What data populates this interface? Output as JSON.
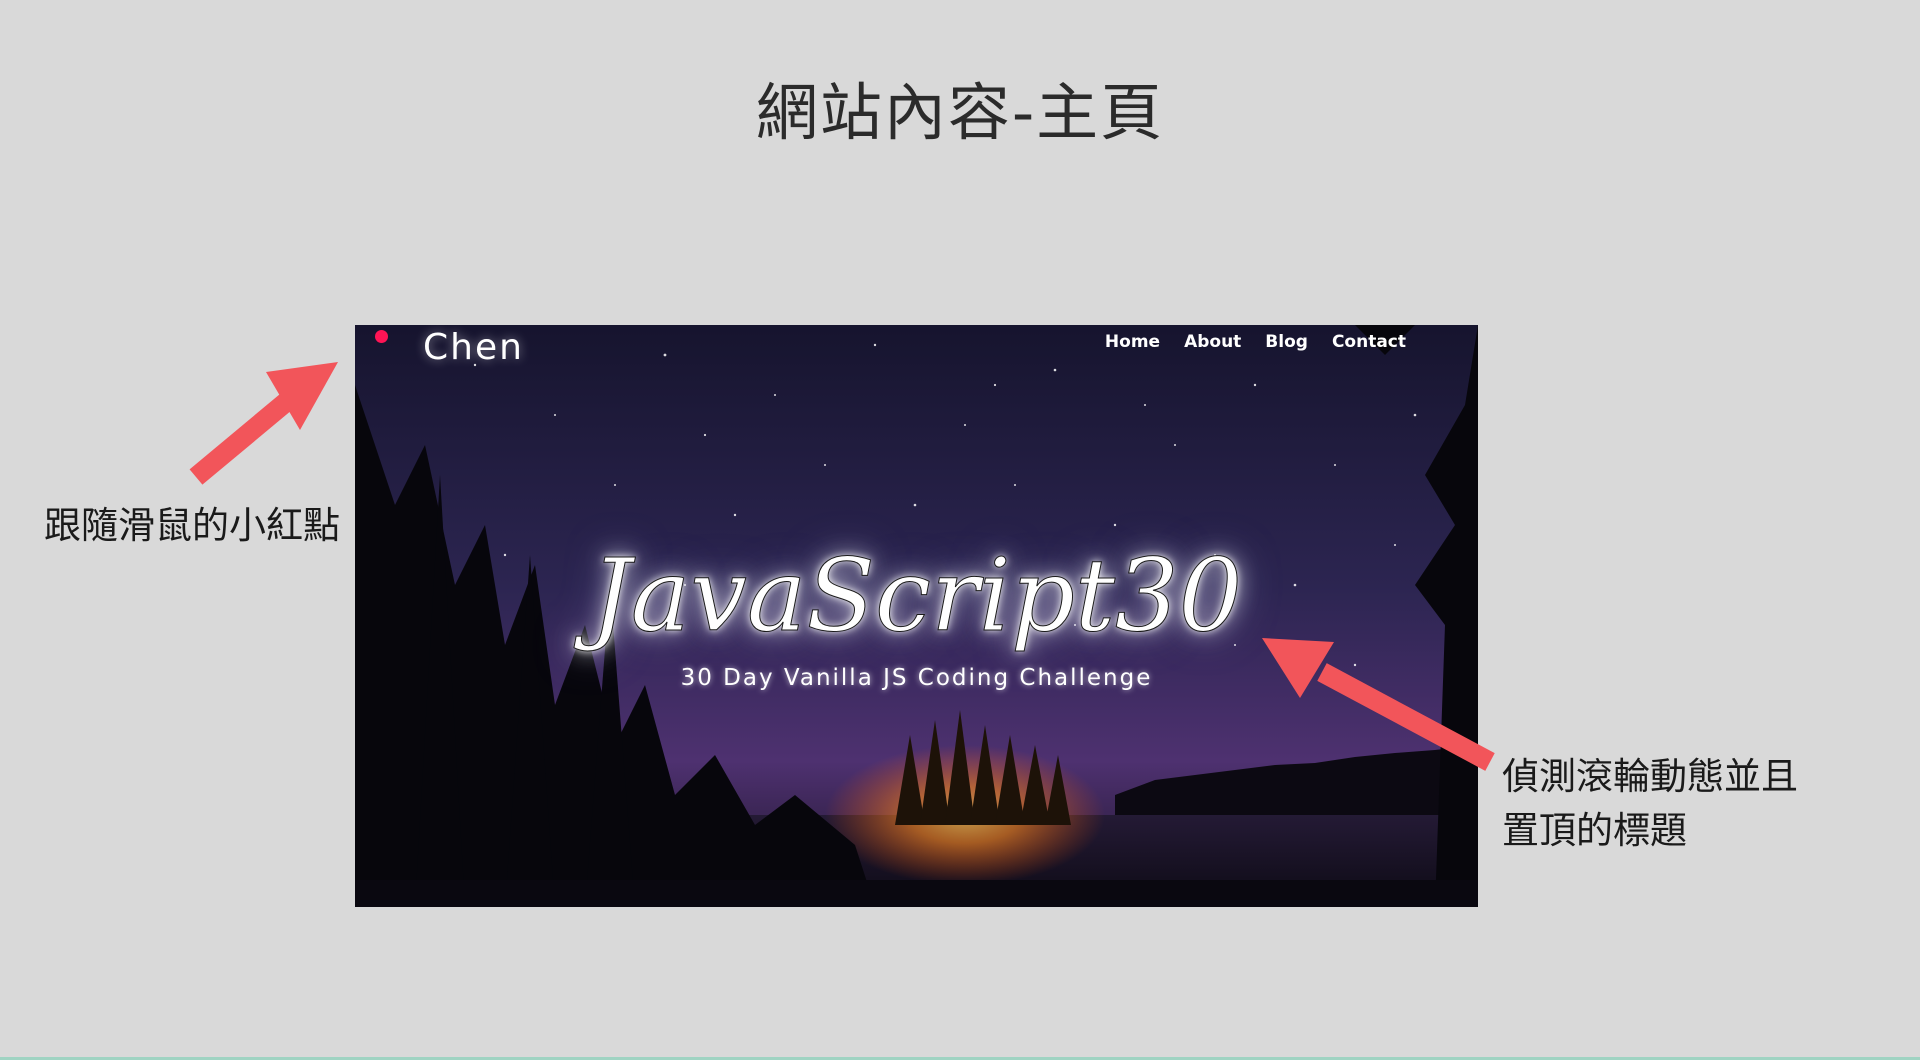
{
  "slide": {
    "title": "網站內容-主頁"
  },
  "site": {
    "logo": "Chen",
    "nav": [
      "Home",
      "About",
      "Blog",
      "Contact"
    ],
    "hero_title": "JavaScript30",
    "hero_subtitle": "30 Day Vanilla JS Coding Challenge"
  },
  "annotations": {
    "left_note": "跟隨滑鼠的小紅點",
    "right_note_line1": "偵測滾輪動態並且",
    "right_note_line2": "置頂的標題"
  },
  "colors": {
    "background": "#d9d9d9",
    "arrow": "#f2555a",
    "mouse_dot": "#ff1455",
    "sky_top": "#1a1838",
    "sky_bottom": "#4b2f6a"
  },
  "icons": {
    "mouse_dot": "red-dot-icon",
    "arrow": "arrow-icon"
  }
}
